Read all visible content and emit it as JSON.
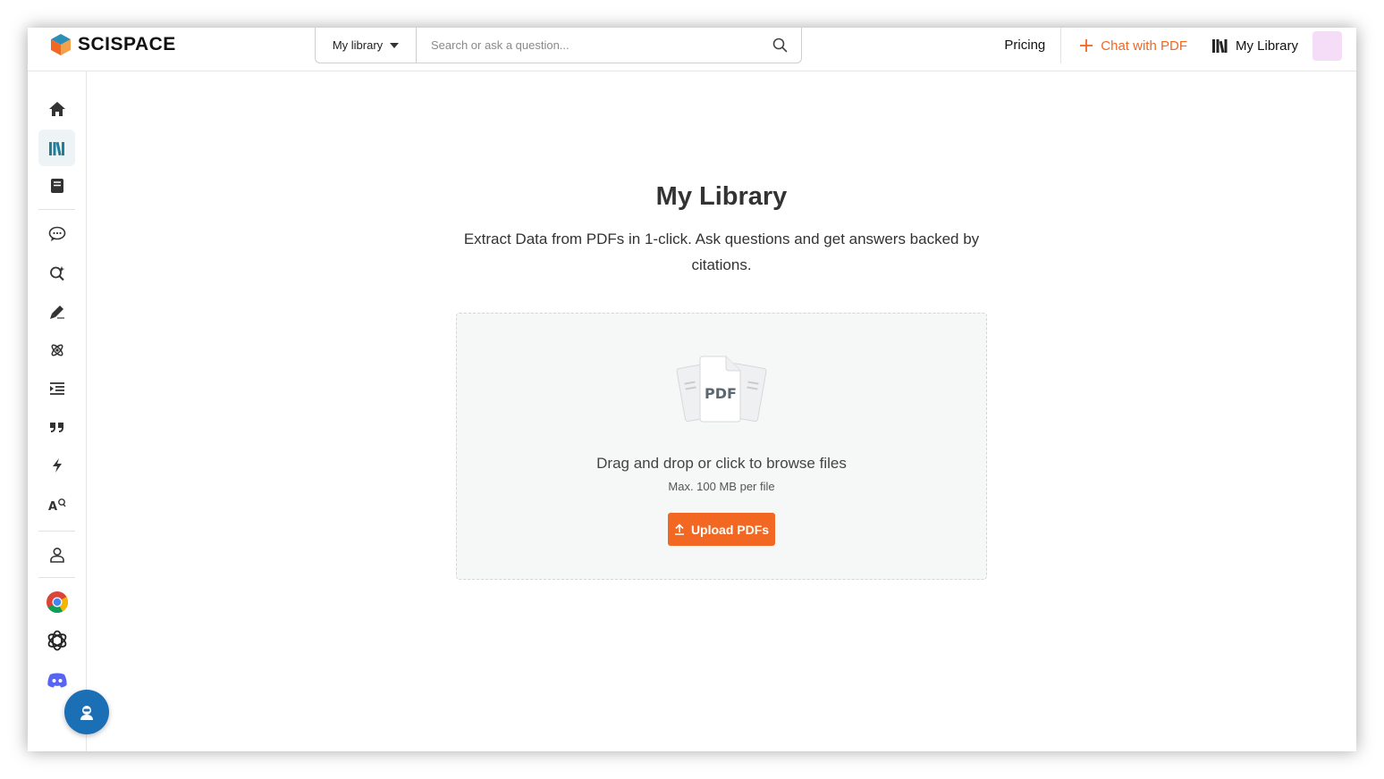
{
  "header": {
    "brand": "SCISPACE",
    "library_select": "My library",
    "search_placeholder": "Search or ask a question...",
    "nav": {
      "pricing": "Pricing",
      "chat_with_pdf": "Chat with PDF",
      "my_library": "My Library"
    }
  },
  "sidebar": {
    "items": [
      {
        "icon": "home-icon"
      },
      {
        "icon": "library-icon",
        "active": true
      },
      {
        "icon": "notebook-icon"
      },
      {
        "icon": "chat-icon"
      },
      {
        "icon": "search-literature-icon"
      },
      {
        "icon": "pen-icon"
      },
      {
        "icon": "atom-icon"
      },
      {
        "icon": "outline-icon"
      },
      {
        "icon": "quote-icon"
      },
      {
        "icon": "lightning-icon"
      },
      {
        "icon": "ai-detector-icon"
      },
      {
        "icon": "user-icon"
      },
      {
        "icon": "chrome-icon"
      },
      {
        "icon": "openai-icon"
      },
      {
        "icon": "discord-icon"
      }
    ]
  },
  "main": {
    "title": "My Library",
    "subtitle": "Extract Data from PDFs in 1-click. Ask questions and get answers backed by citations.",
    "dropzone": {
      "graphic_label": "PDF",
      "title": "Drag and drop or click to browse files",
      "subtitle": "Max. 100 MB per file",
      "upload_button": "Upload PDFs"
    }
  },
  "colors": {
    "accent": "#f26722",
    "fab": "#1a6fb5",
    "sidebar_active_icon": "#1e7f9a"
  }
}
